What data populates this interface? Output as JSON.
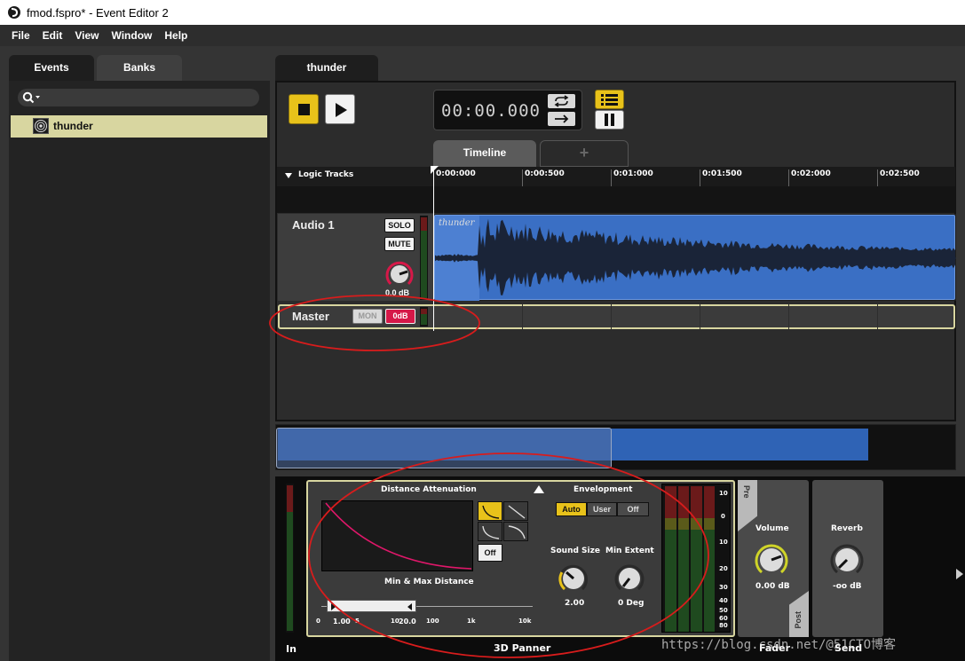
{
  "window": {
    "title": "fmod.fspro* - Event Editor 2"
  },
  "menu": {
    "items": [
      "File",
      "Edit",
      "View",
      "Window",
      "Help"
    ]
  },
  "left_panel": {
    "tabs": [
      "Events",
      "Banks"
    ],
    "search_placeholder": "",
    "events": [
      {
        "name": "thunder",
        "selected": true
      }
    ]
  },
  "editor": {
    "tab_label": "thunder",
    "time_display": "00:00.000",
    "view_tabs": [
      "Timeline",
      "+"
    ],
    "logic_tracks_label": "Logic Tracks",
    "ruler": [
      "0:00:000",
      "0:00:500",
      "0:01:000",
      "0:01:500",
      "0:02:000",
      "0:02:500"
    ],
    "tracks": [
      {
        "name": "Audio 1",
        "solo_label": "SOLO",
        "mute_label": "MUTE",
        "volume": "0.0 dB",
        "clip_name": "thunder"
      }
    ],
    "master": {
      "name": "Master",
      "mon_label": "MON",
      "odb_label": "0dB"
    }
  },
  "deck": {
    "in_label": "In",
    "panner": {
      "title": "3D Panner",
      "distance_attenuation_label": "Distance Attenuation",
      "curve_off_label": "Off",
      "min_max_label": "Min & Max Distance",
      "min_value": "1.00",
      "max_value": "20.0",
      "scale": [
        "0",
        "1",
        "5",
        "10",
        "100",
        "1k",
        "10k"
      ],
      "envelopment_label": "Envelopment",
      "envelopment_options": [
        "Auto",
        "User",
        "Off"
      ],
      "envelopment_selected": "Auto",
      "sound_size_label": "Sound Size",
      "sound_size_value": "2.00",
      "min_extent_label": "Min Extent",
      "min_extent_value": "0 Deg"
    },
    "meter_scale": [
      "10",
      "0",
      "10",
      "20",
      "30",
      "40",
      "50",
      "60",
      "80"
    ],
    "fader": {
      "pre_label": "Pre",
      "volume_label": "Volume",
      "volume_value": "0.00 dB",
      "post_label": "Post",
      "title": "Fader"
    },
    "send": {
      "reverb_label": "Reverb",
      "reverb_value": "-oo dB",
      "title": "Send"
    }
  },
  "watermark": "https://blog.csdn.net/@51CTO博客",
  "colors": {
    "accent_yellow": "#e8c21a",
    "waveform_blue": "#3a6fc4",
    "annotation_red": "#d81c1c",
    "selection_cream": "#d8d6a0",
    "odb_red": "#d61848"
  }
}
